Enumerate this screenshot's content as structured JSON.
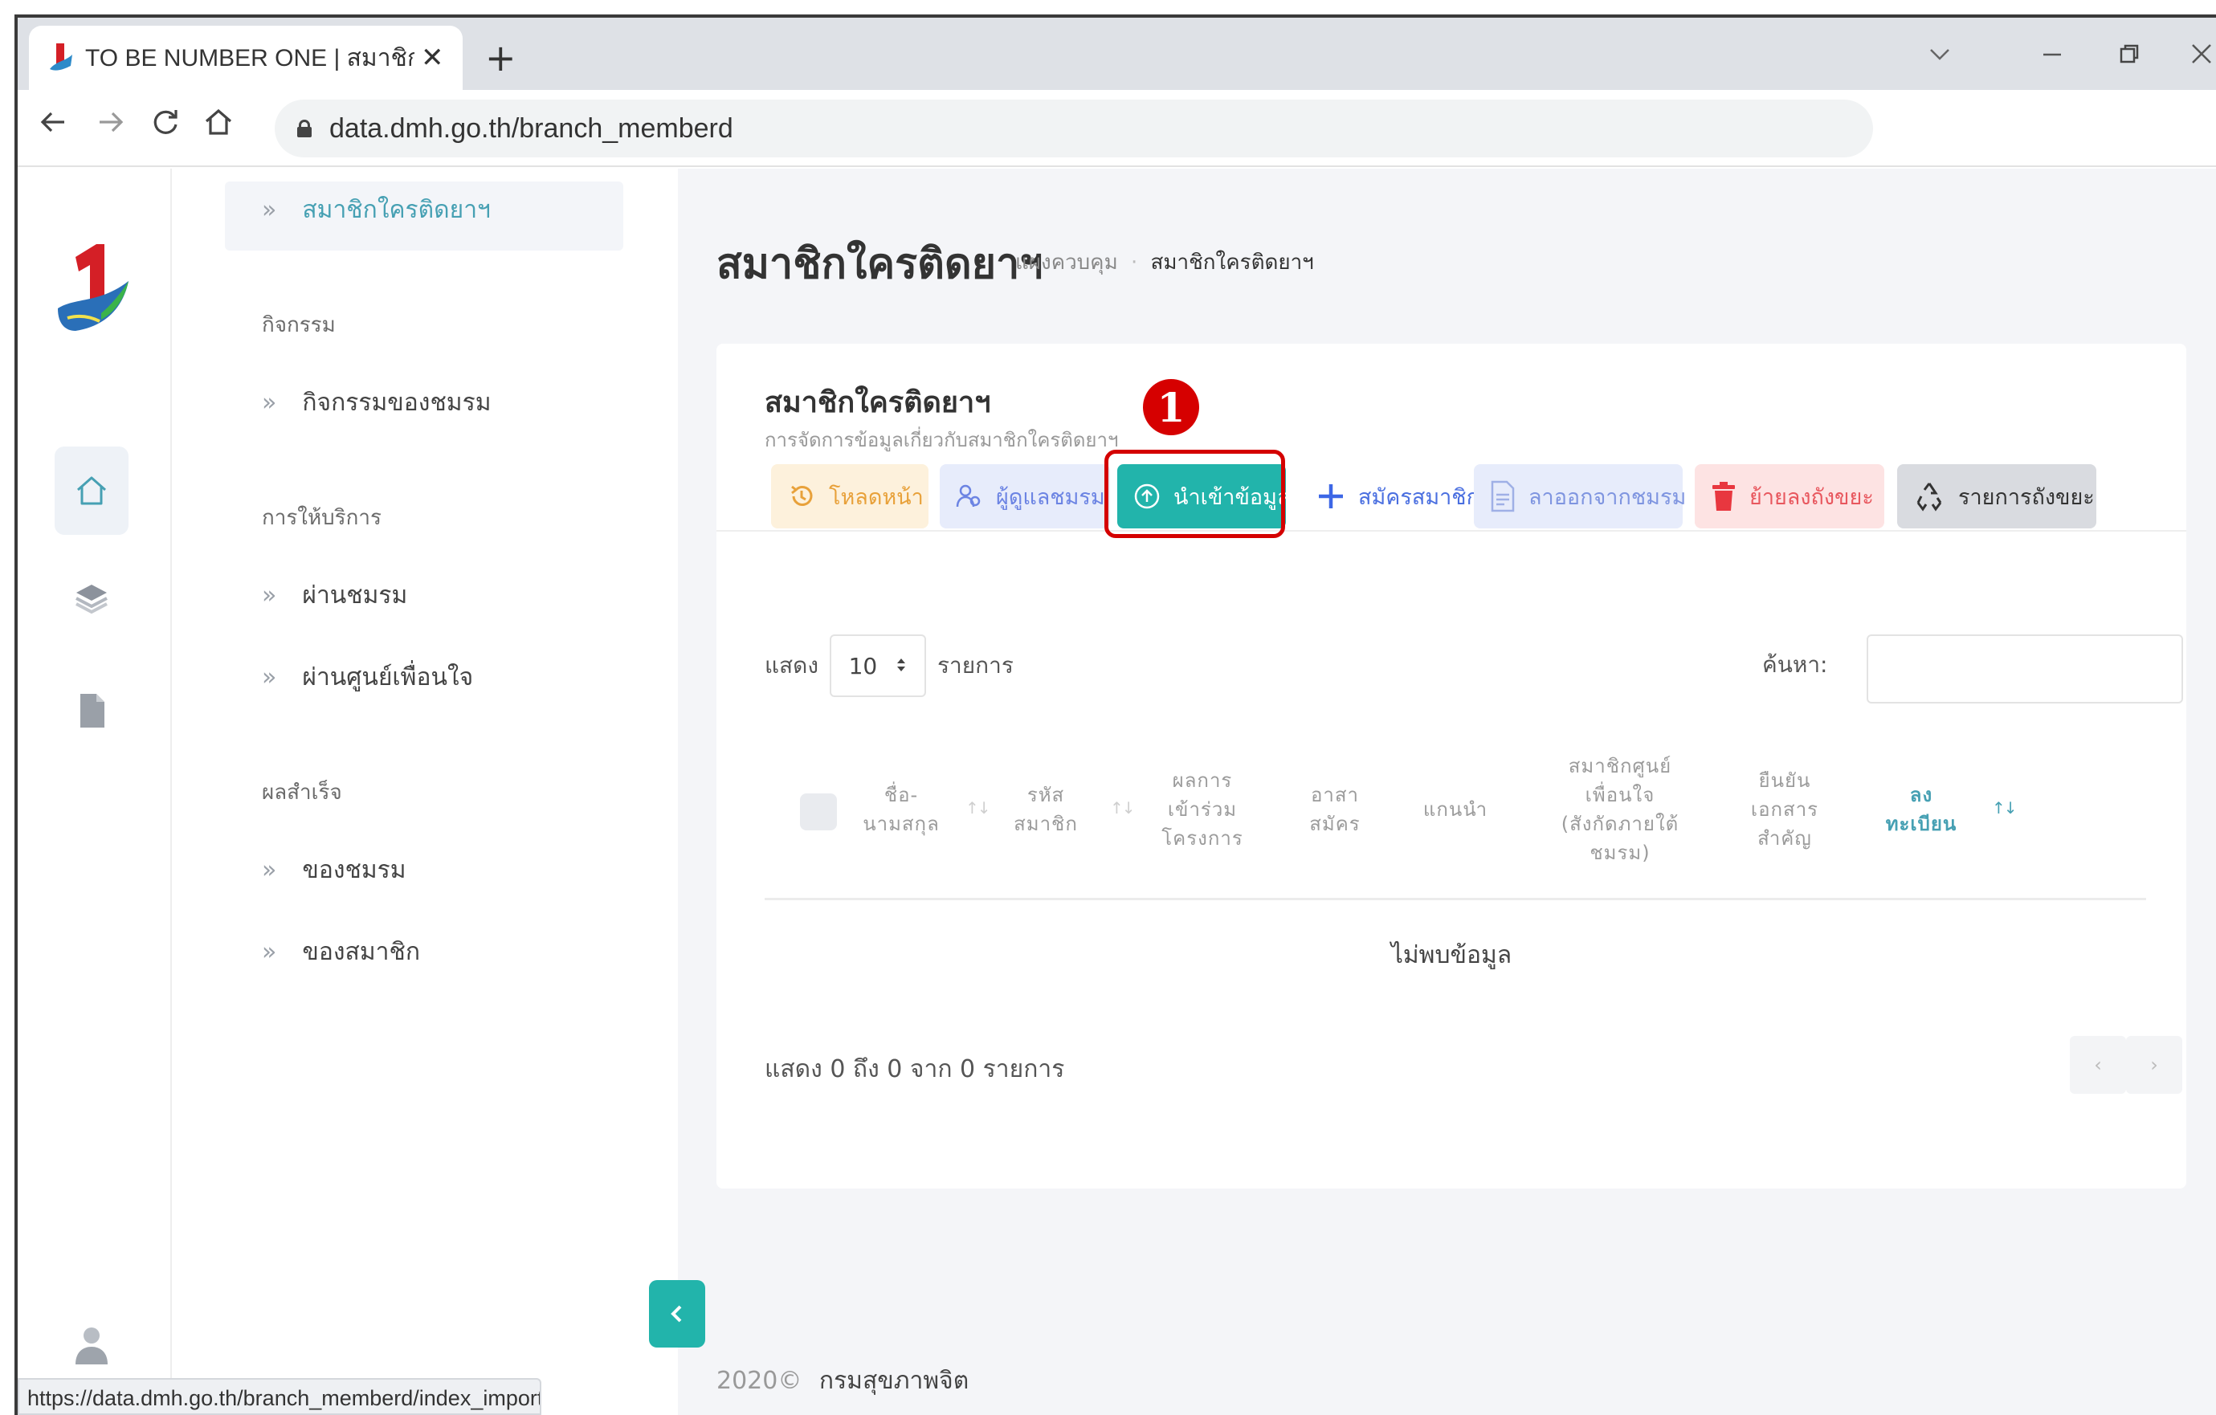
{
  "browser": {
    "tab_title": "TO BE NUMBER ONE | สมาชิกใครติ",
    "tab_close": "✕",
    "new_tab": "+",
    "url": "data.dmh.go.th/branch_memberd",
    "status_url": "https://data.dmh.go.th/branch_memberd/index_import",
    "icons": [
      "back-arrow-icon",
      "forward-arrow-icon",
      "reload-icon",
      "home-icon",
      "lock-icon",
      "minimize-icon",
      "restore-icon",
      "close-window-icon"
    ]
  },
  "sidebar": {
    "active_item": "สมาชิกใครติดยาฯ",
    "sections": [
      {
        "title": "กิจกรรม",
        "items": [
          "กิจกรรมของชมรม"
        ]
      },
      {
        "title": "การให้บริการ",
        "items": [
          "ผ่านชมรม",
          "ผ่านศูนย์เพื่อนใจ"
        ]
      },
      {
        "title": "ผลสำเร็จ",
        "items": [
          "ของชมรม",
          "ของสมาชิก"
        ]
      }
    ],
    "rail_icons": [
      "home-icon",
      "layers-icon",
      "file-icon",
      "user-icon"
    ]
  },
  "page": {
    "title": "สมาชิกใครติดยาฯ",
    "breadcrumb_root": "แผงควบคุม",
    "breadcrumb_sep": "·",
    "breadcrumb_current": "สมาชิกใครติดยาฯ"
  },
  "card": {
    "title": "สมาชิกใครติดยาฯ",
    "subtitle": "การจัดการข้อมูลเกี่ยวกับสมาชิกใครติดยาฯ",
    "marker": "1",
    "buttons": [
      {
        "label": "โหลดหน้า",
        "icon": "reload-history-icon"
      },
      {
        "label": "ผู้ดูแลชมรม",
        "icon": "users-icon"
      },
      {
        "label": "นำเข้าข้อมูล",
        "icon": "upload-cloud-icon"
      },
      {
        "label": "สมัครสมาชิก",
        "icon": "plus-icon"
      },
      {
        "label": "ลาออกจากชมรม",
        "icon": "document-icon"
      },
      {
        "label": "ย้ายลงถังขยะ",
        "icon": "trash-icon"
      },
      {
        "label": "รายการถังขยะ",
        "icon": "recycle-icon"
      }
    ],
    "colors": {
      "accent": "#22b4ab",
      "highlight": "#d40000"
    }
  },
  "table": {
    "show_label": "แสดง",
    "page_size": "10",
    "entries_label": "รายการ",
    "search_label": "ค้นหา:",
    "columns": [
      "ชื่อ-\nนามสกุล",
      "รหัส\nสมาชิก",
      "ผลการ\nเข้าร่วม\nโครงการ",
      "อาสา\nสมัคร",
      "แกนนำ",
      "สมาชิกศูนย์\nเพื่อนใจ\n(สังกัดภายใต้\nชมรม)",
      "ยืนยัน\nเอกสาร\nสำคัญ",
      "ลง\nทะเบียน"
    ],
    "sort_glyph": "↑↓",
    "empty_text": "ไม่พบข้อมูล",
    "info_text": "แสดง 0 ถึง 0 จาก 0 รายการ",
    "prev": "‹",
    "next": "›"
  },
  "footer": {
    "year": "2020©",
    "org": "กรมสุขภาพจิต"
  }
}
